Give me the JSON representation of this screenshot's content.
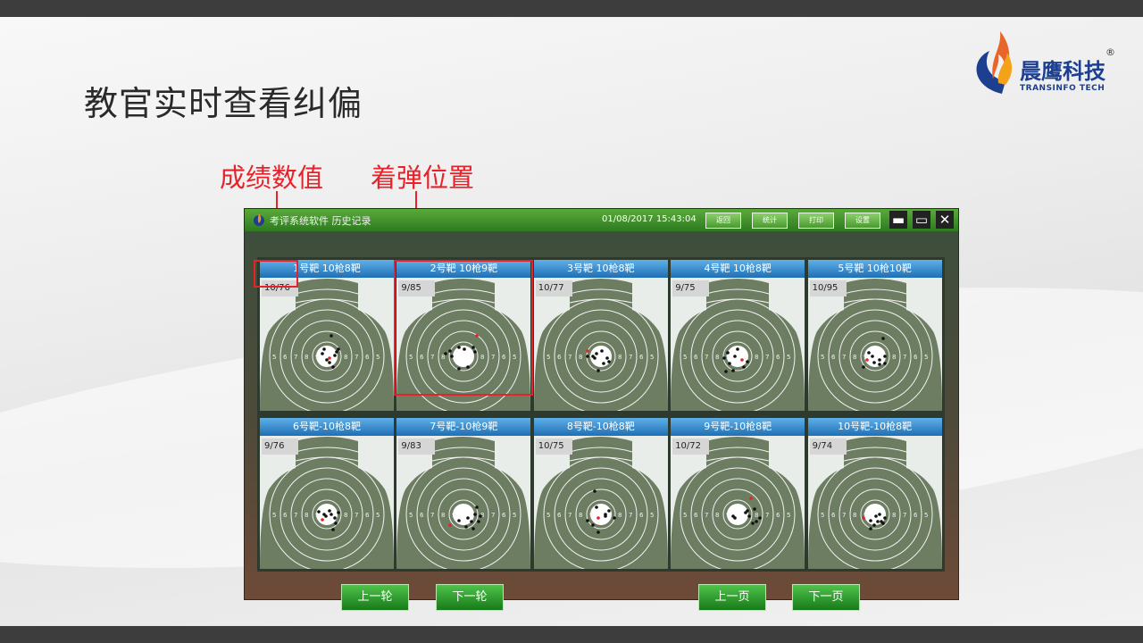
{
  "slide": {
    "title": "教官实时查看纠偏",
    "annotations": {
      "score_label": "成绩数值",
      "impact_label": "着弹位置"
    },
    "logo": {
      "name_cn": "晨鹰科技",
      "name_en": "TRANSINFO TECH",
      "registered": "®"
    }
  },
  "app": {
    "title": "考评系统软件  历史记录",
    "datetime": "01/08/2017  15:43:04",
    "toolbar": [
      "返回",
      "统计",
      "打印",
      "设置"
    ],
    "window_controls": [
      "minimize",
      "maximize",
      "close"
    ],
    "targets": [
      {
        "header": "1号靶  10枪8靶",
        "score": "10/76"
      },
      {
        "header": "2号靶  10枪9靶",
        "score": "9/85"
      },
      {
        "header": "3号靶  10枪8靶",
        "score": "10/77"
      },
      {
        "header": "4号靶  10枪8靶",
        "score": "9/75"
      },
      {
        "header": "5号靶  10枪10靶",
        "score": "10/95"
      },
      {
        "header": "6号靶-10枪8靶",
        "score": "9/76"
      },
      {
        "header": "7号靶-10枪9靶",
        "score": "9/83"
      },
      {
        "header": "8号靶-10枪8靶",
        "score": "10/75"
      },
      {
        "header": "9号靶-10枪8靶",
        "score": "10/72"
      },
      {
        "header": "10号靶-10枪8靶",
        "score": "9/74"
      }
    ],
    "ring_numbers": [
      "5",
      "6",
      "7",
      "8",
      "9"
    ],
    "bottom_buttons": {
      "prev_round": "上一轮",
      "next_round": "下一轮",
      "prev_page": "上一页",
      "next_page": "下一页"
    },
    "colors": {
      "target_fill": "#6c7d62",
      "target_line": "#f2f2f2",
      "header": "#1f6fb5",
      "annotation": "#e5232b"
    }
  }
}
